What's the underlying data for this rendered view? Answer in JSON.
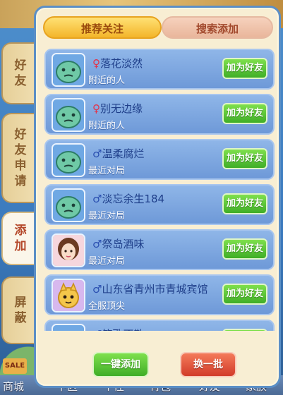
{
  "side_tabs": [
    {
      "label": "好友"
    },
    {
      "label": "好友申请"
    },
    {
      "label": "添加"
    },
    {
      "label": "屏蔽"
    }
  ],
  "top_tabs": {
    "recommended": "推荐关注",
    "search_add": "搜索添加"
  },
  "players": [
    {
      "gender": "♀",
      "name": "落花淡然",
      "source": "附近的人",
      "button": "加为好友",
      "avatar": "default"
    },
    {
      "gender": "♀",
      "name": "别无边缘",
      "source": "附近的人",
      "button": "加为好友",
      "avatar": "default"
    },
    {
      "gender": "♂",
      "name": "温柔腐烂",
      "source": "最近对局",
      "button": "加为好友",
      "avatar": "default"
    },
    {
      "gender": "♂",
      "name": "淡忘余生184",
      "source": "最近对局",
      "button": "加为好友",
      "avatar": "default"
    },
    {
      "gender": "♂",
      "name": "祭岛酒味",
      "source": "最近对局",
      "button": "加为好友",
      "avatar": "girl"
    },
    {
      "gender": "♂",
      "name": "山东省青州市青城宾馆",
      "source": "全服顶尖",
      "button": "加为好友",
      "avatar": "cat"
    },
    {
      "gender": "♂",
      "name": "笑歌不散",
      "source": "",
      "button": "加为好友",
      "avatar": "default"
    }
  ],
  "footer": {
    "add_all": "一键添加",
    "refresh": "换一批"
  },
  "bottom_bar": [
    "商城",
    "下区",
    "个性",
    "背包",
    "好友",
    "家族"
  ],
  "badges": {
    "sale": "SALE"
  },
  "colors": {
    "female": "#e2334a",
    "male": "#2a4fb0",
    "add_button": "#3fae27",
    "refresh_button": "#d23c2a"
  }
}
